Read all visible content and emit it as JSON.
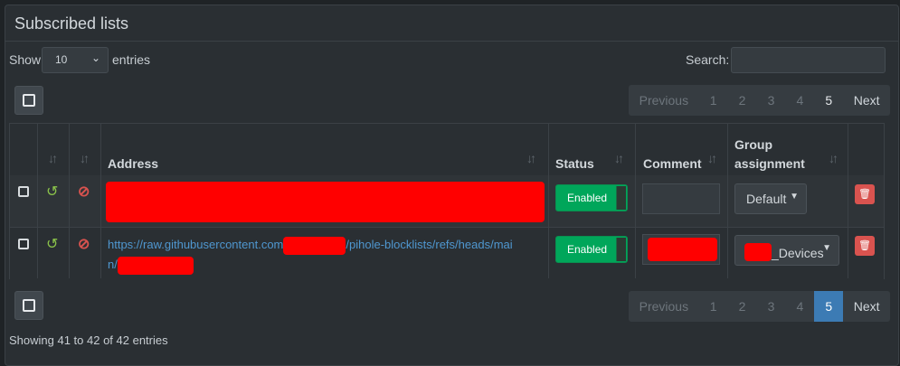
{
  "panel": {
    "title": "Subscribed lists"
  },
  "length_menu": {
    "show_label": "Show",
    "selected": "10",
    "entries_label": "entries"
  },
  "search": {
    "label": "Search:",
    "value": ""
  },
  "pagination": {
    "previous": "Previous",
    "pages": [
      "1",
      "2",
      "3",
      "4",
      "5"
    ],
    "current_page": 5,
    "next": "Next"
  },
  "table": {
    "columns": [
      "Address",
      "Status",
      "Comment",
      "Group assignment"
    ],
    "group_header_lines": [
      "Group",
      "assignment"
    ],
    "rows": [
      {
        "address": "",
        "status": "Enabled",
        "comment": "",
        "group": "Default"
      },
      {
        "address_part1": "https://raw.githubusercontent.com",
        "address_part2": "/pihole-blocklists/refs/heads/mai",
        "address_part3": "n/",
        "status": "Enabled",
        "comment": "",
        "group": "_Devices"
      }
    ]
  },
  "info": "Showing 41 to 42 of 42 entries",
  "colors": {
    "enabled": "#00a65a",
    "danger": "#d9534f",
    "link": "#4f97d0",
    "active_page": "#3c7bb4",
    "redaction": "#ff0000"
  },
  "icons": {
    "history": "history-icon",
    "blocked": "ban-icon",
    "delete": "trash-icon",
    "sort": "sort-icon",
    "caret": "caret-down-icon"
  }
}
